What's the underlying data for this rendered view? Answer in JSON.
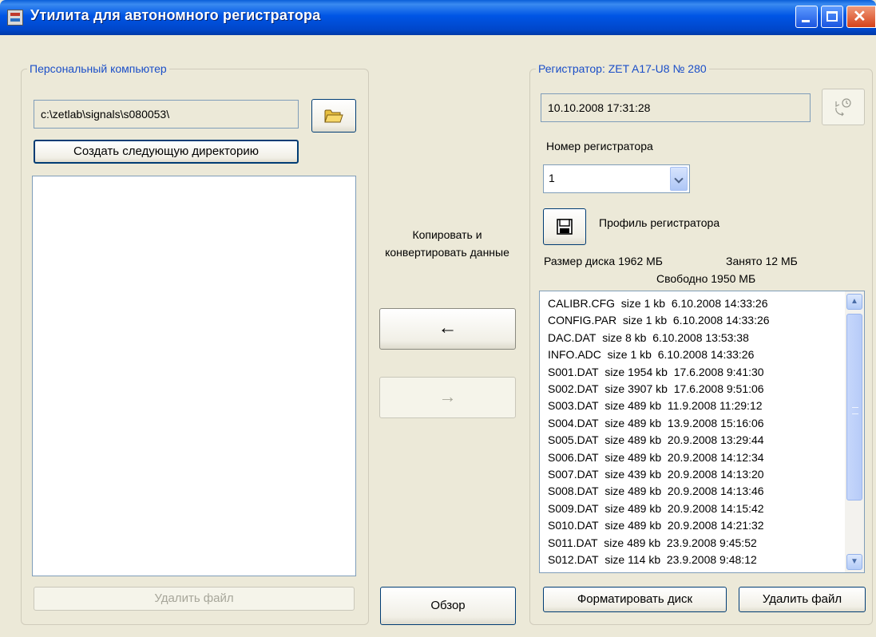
{
  "window": {
    "title": "Утилита для автономного регистратора",
    "icon": "app-icon",
    "controls": [
      "minimize-icon",
      "maximize-icon",
      "close-icon"
    ]
  },
  "pc": {
    "group_title": "Персональный компьютер",
    "path": "c:\\zetlab\\signals\\s080053\\",
    "browse_icon": "folder-open-icon",
    "create_dir_label": "Создать следующую директорию",
    "delete_label": "Удалить файл"
  },
  "middle": {
    "copy_text": "Копировать и конвертировать данные",
    "copy_to_pc_label": "←",
    "copy_to_recorder_label": "→",
    "browse_label": "Обзор"
  },
  "recorder": {
    "group_title": "Регистратор: ZET A17-U8 № 280",
    "datetime": "10.10.2008 17:31:28",
    "sync_icon": "clock-sync-icon",
    "number_label": "Номер регистратора",
    "number_value": "1",
    "profile_icon": "floppy-disk-icon",
    "profile_label": "Профиль регистратора",
    "disk_size": "Размер диска 1962 МБ",
    "used": "Занято 12 МБ",
    "free": "Свободно 1950 МБ",
    "files": [
      "CALIBR.CFG  size 1 kb  6.10.2008 14:33:26",
      "CONFIG.PAR  size 1 kb  6.10.2008 14:33:26",
      "DAC.DAT  size 8 kb  6.10.2008 13:53:38",
      "INFO.ADC  size 1 kb  6.10.2008 14:33:26",
      "S001.DAT  size 1954 kb  17.6.2008 9:41:30",
      "S002.DAT  size 3907 kb  17.6.2008 9:51:06",
      "S003.DAT  size 489 kb  11.9.2008 11:29:12",
      "S004.DAT  size 489 kb  13.9.2008 15:16:06",
      "S005.DAT  size 489 kb  20.9.2008 13:29:44",
      "S006.DAT  size 489 kb  20.9.2008 14:12:34",
      "S007.DAT  size 439 kb  20.9.2008 14:13:20",
      "S008.DAT  size 489 kb  20.9.2008 14:13:46",
      "S009.DAT  size 489 kb  20.9.2008 14:15:42",
      "S010.DAT  size 489 kb  20.9.2008 14:21:32",
      "S011.DAT  size 489 kb  23.9.2008 9:45:52",
      "S012.DAT  size 114 kb  23.9.2008 9:48:12"
    ],
    "format_label": "Форматировать диск",
    "delete_label": "Удалить файл"
  }
}
